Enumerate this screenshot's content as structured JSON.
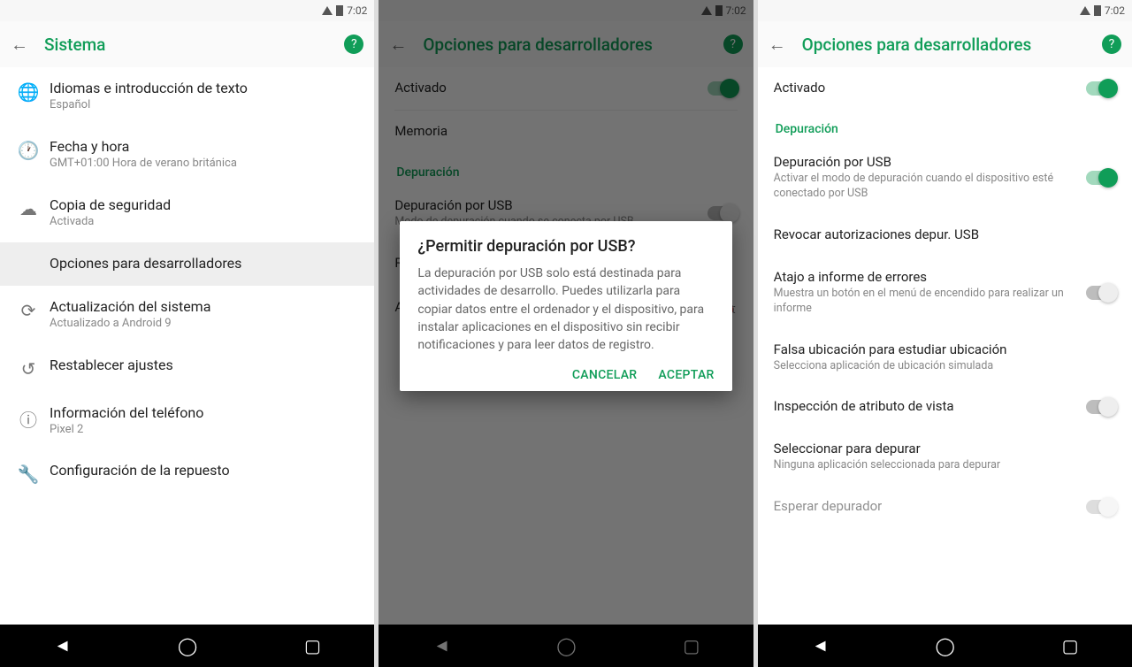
{
  "status": {
    "time": "7:02"
  },
  "left": {
    "title": "Sistema",
    "items": [
      {
        "icon": "🌐",
        "t1": "Idiomas e introducción de texto",
        "t2": "Español"
      },
      {
        "icon": "🕐",
        "t1": "Fecha y hora",
        "t2": "GMT+01:00 Hora de verano británica"
      },
      {
        "icon": "☁",
        "t1": "Copia de seguridad",
        "t2": "Activada"
      },
      {
        "icon": "",
        "t1": "Opciones para desarrolladores",
        "t2": "",
        "hl": true
      },
      {
        "icon": "⟳",
        "t1": "Actualización del sistema",
        "t2": "Actualizado a Android 9"
      },
      {
        "icon": "↺",
        "t1": "Restablecer ajustes",
        "t2": ""
      },
      {
        "icon": "ⓘ",
        "t1": "Información del teléfono",
        "t2": "Pixel 2"
      },
      {
        "icon": "🔧",
        "t1": "Configuración de la repuesto",
        "t2": ""
      }
    ]
  },
  "mid": {
    "title": "Opciones para desarrolladores",
    "row1": {
      "t1": "Activado"
    },
    "row2": {
      "t1": "Memoria",
      "t2": ""
    },
    "section": "Depuración",
    "row3": {
      "t1": "Depuración por USB",
      "t2": "Modo de depuración cuando se conecta por USB"
    },
    "row4": {
      "t1": "Revocar autorizaciones depur. USB"
    },
    "row5": {
      "t1": "Abrir informe de errores"
    },
    "dialog": {
      "title": "¿Permitir depuración por USB?",
      "body": "La depuración por USB solo está destinada para actividades de desarrollo. Puedes utilizarla para copiar datos entre el ordenador y el dispositivo, para instalar aplicaciones en el dispositivo sin recibir notificaciones y para leer datos de registro.",
      "cancel": "Cancelar",
      "ok": "Aceptar"
    }
  },
  "right": {
    "title": "Opciones para desarrolladores",
    "row1": {
      "t1": "Activado"
    },
    "section": "Depuración",
    "row2": {
      "t1": "Depuración por USB",
      "t2": "Activar el modo de depuración cuando el dispositivo esté conectado por USB"
    },
    "row3": {
      "t1": "Revocar autorizaciones depur. USB"
    },
    "row4": {
      "t1": "Atajo a informe de errores",
      "t2": "Muestra un botón en el menú de encendido para realizar un informe"
    },
    "row5": {
      "t1": "Falsa ubicación para estudiar ubicación",
      "t2": "Selecciona aplicación de ubicación simulada"
    },
    "row6": {
      "t1": "Inspección de atributo de vista"
    },
    "row7": {
      "t1": "Seleccionar para depurar",
      "t2": "Ninguna aplicación seleccionada para depurar"
    },
    "row8": {
      "t1": "Esperar depurador"
    }
  }
}
